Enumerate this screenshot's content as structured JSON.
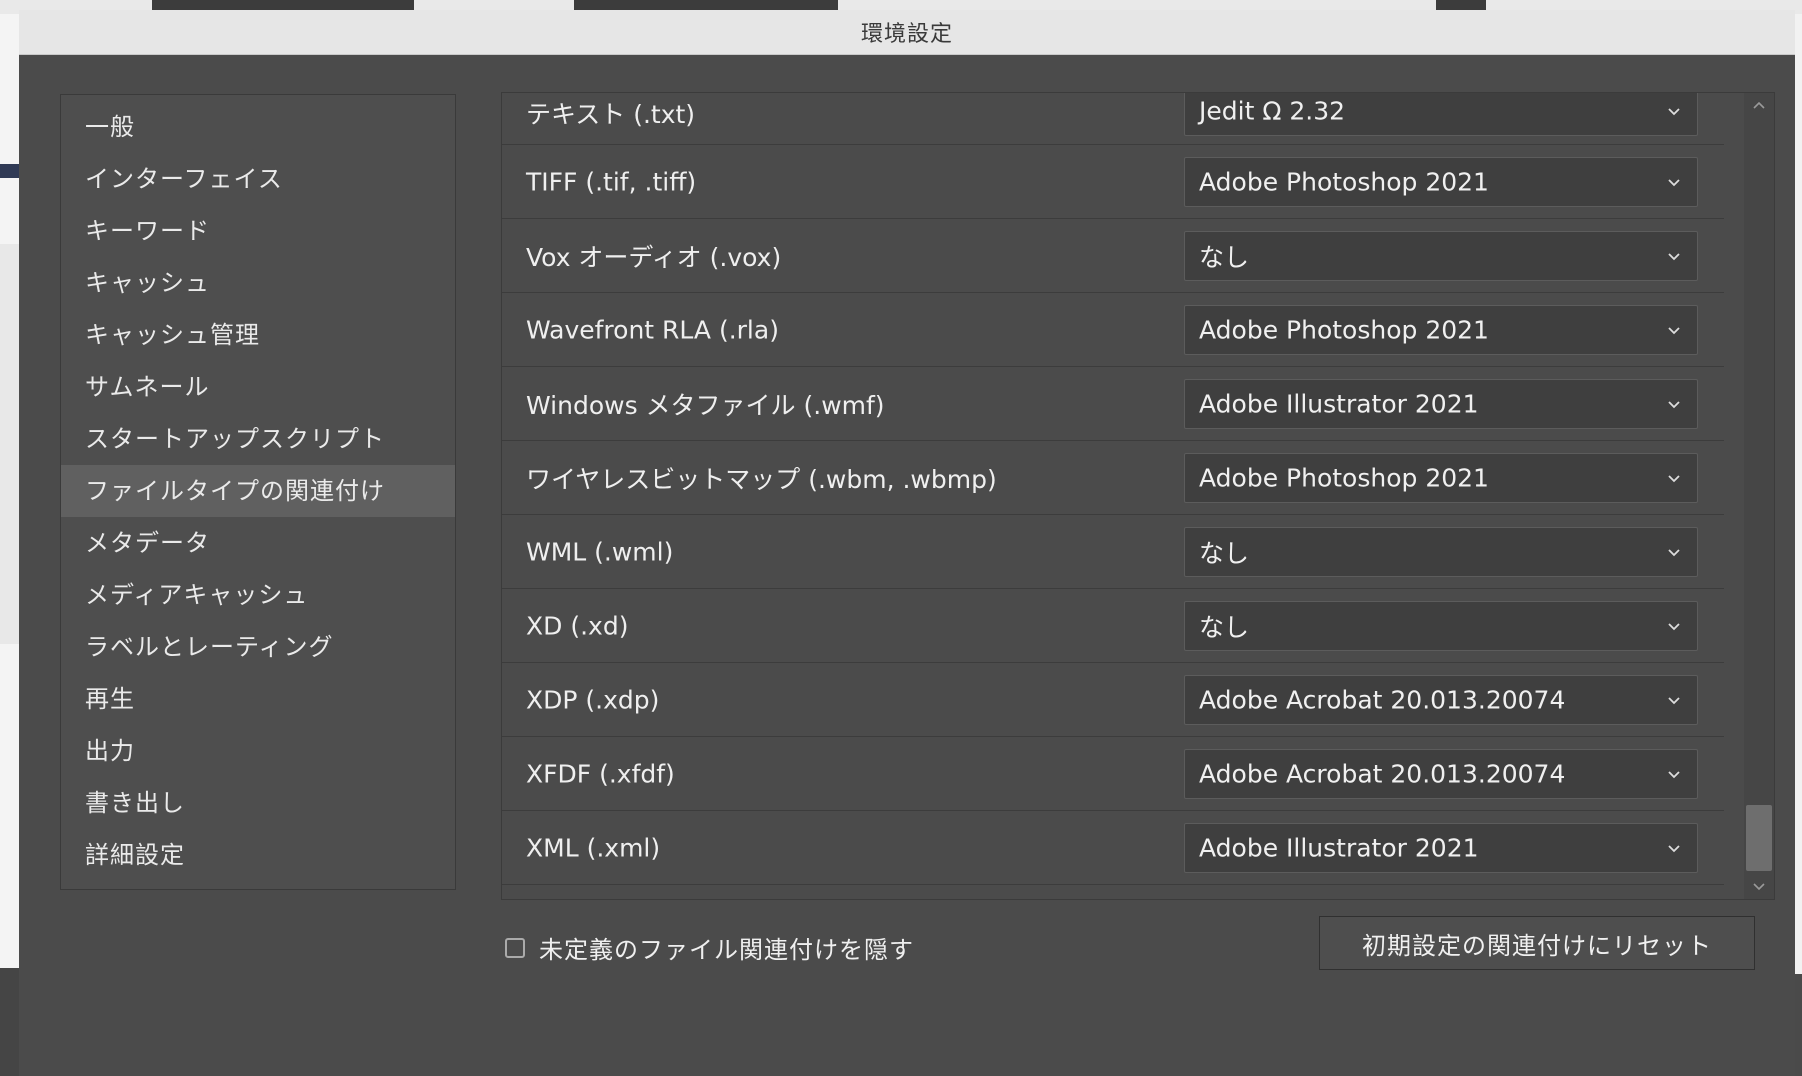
{
  "window": {
    "title": "環境設定"
  },
  "sidebar": {
    "items": [
      {
        "label": "一般"
      },
      {
        "label": "インターフェイス"
      },
      {
        "label": "キーワード"
      },
      {
        "label": "キャッシュ"
      },
      {
        "label": "キャッシュ管理"
      },
      {
        "label": "サムネール"
      },
      {
        "label": "スタートアップスクリプト"
      },
      {
        "label": "ファイルタイプの関連付け",
        "selected": true
      },
      {
        "label": "メタデータ"
      },
      {
        "label": "メディアキャッシュ"
      },
      {
        "label": "ラベルとレーティング"
      },
      {
        "label": "再生"
      },
      {
        "label": "出力"
      },
      {
        "label": "書き出し"
      },
      {
        "label": "詳細設定"
      }
    ]
  },
  "associations": [
    {
      "file_type": "テキスト (.txt)",
      "app": "Jedit Ω 2.32"
    },
    {
      "file_type": "TIFF (.tif, .tiff)",
      "app": "Adobe Photoshop 2021"
    },
    {
      "file_type": "Vox オーディオ (.vox)",
      "app": "なし"
    },
    {
      "file_type": "Wavefront RLA (.rla)",
      "app": "Adobe Photoshop 2021"
    },
    {
      "file_type": "Windows メタファイル (.wmf)",
      "app": "Adobe Illustrator 2021"
    },
    {
      "file_type": "ワイヤレスビットマップ (.wbm, .wbmp)",
      "app": "Adobe Photoshop 2021"
    },
    {
      "file_type": "WML (.wml)",
      "app": "なし"
    },
    {
      "file_type": "XD (.xd)",
      "app": "なし"
    },
    {
      "file_type": "XDP (.xdp)",
      "app": "Adobe Acrobat 20.013.20074"
    },
    {
      "file_type": "XFDF (.xfdf)",
      "app": "Adobe Acrobat 20.013.20074"
    },
    {
      "file_type": "XML (.xml)",
      "app": "Adobe Illustrator 2021"
    }
  ],
  "footer": {
    "hide_undefined_label": "未定義のファイル関連付けを隠す",
    "hide_undefined_checked": false,
    "reset_button_label": "初期設定の関連付けにリセット"
  },
  "colors": {
    "window_bg": "#4b4b4b",
    "selected_item_bg": "#606060",
    "dropdown_bg": "#3f3f3f",
    "titlebar_bg": "#e6e6e6"
  },
  "icons": {
    "dropdown": "chevron-down-icon",
    "scroll_up": "chevron-up-icon",
    "scroll_down": "chevron-down-icon"
  }
}
